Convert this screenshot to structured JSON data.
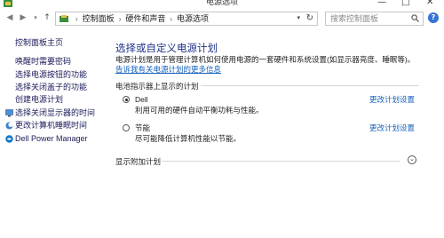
{
  "window": {
    "title": "电源选项",
    "controls": [
      "—",
      "□",
      "✕"
    ]
  },
  "address": {
    "breadcrumb": [
      "控制面板",
      "硬件和声音",
      "电源选项"
    ],
    "search_placeholder": "搜索控制面板",
    "help": "?"
  },
  "sidebar": {
    "home": "控制面板主页",
    "links": [
      {
        "label": "唤醒时需要密码",
        "icon": null
      },
      {
        "label": "选择电源按钮的功能",
        "icon": null
      },
      {
        "label": "选择关闭盖子的功能",
        "icon": null
      },
      {
        "label": "创建电源计划",
        "icon": null
      },
      {
        "label": "选择关闭显示器的时间",
        "icon": "display-icon"
      },
      {
        "label": "更改计算机睡眠时间",
        "icon": "moon-icon"
      },
      {
        "label": "Dell Power Manager",
        "icon": "dell-icon"
      }
    ]
  },
  "main": {
    "heading": "选择或自定义电源计划",
    "description": "电源计划是用于管理计算机如何使用电源的一套硬件和系统设置(如显示器亮度、睡眠等)。",
    "description_link": "告诉我有关电源计划的更多信息",
    "section_title": "电池指示器上显示的计划",
    "plans": [
      {
        "name": "Dell",
        "selected": true,
        "description": "利用可用的硬件自动平衡功耗与性能。",
        "change_link": "更改计划设置"
      },
      {
        "name": "节能",
        "selected": false,
        "description": "尽可能降低计算机性能以节能。",
        "change_link": "更改计划设置"
      }
    ],
    "extra_plans": "显示附加计划"
  },
  "colors": {
    "heading": "#1e3287",
    "link": "#1560bd",
    "help_badge": "#3573d6"
  }
}
